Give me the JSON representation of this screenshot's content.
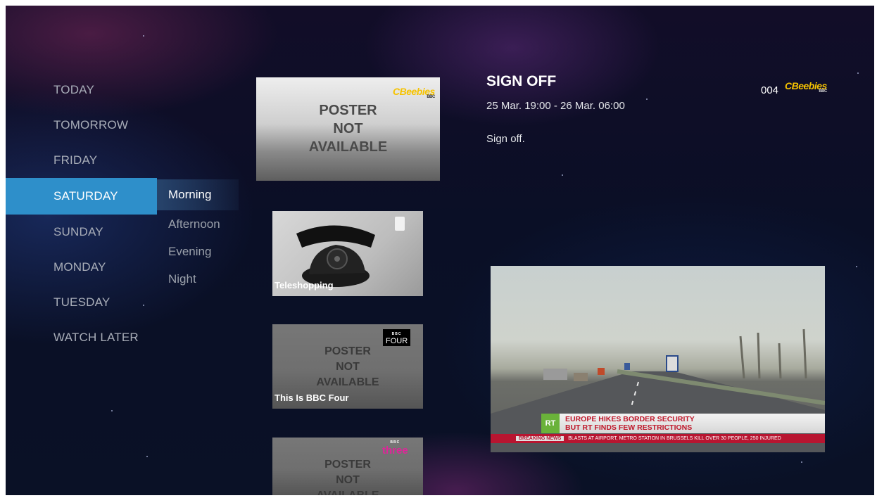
{
  "days": [
    "TODAY",
    "TOMORROW",
    "FRIDAY",
    "SATURDAY",
    "SUNDAY",
    "MONDAY",
    "TUESDAY",
    "WATCH LATER"
  ],
  "active_day": "SATURDAY",
  "times_of_day": [
    "Morning",
    "Afternoon",
    "Evening",
    "Night"
  ],
  "active_time_of_day": "Morning",
  "programs": [
    {
      "poster_lines": [
        "POSTER",
        "NOT",
        "AVAILABLE"
      ],
      "channel_logo": "CBeebies",
      "channel_logo_sub": "BBC"
    },
    {
      "title": "Teleshopping",
      "channel_logo": "channel-logo-icon"
    },
    {
      "title": "This Is BBC Four",
      "poster_lines": [
        "POSTER",
        "NOT",
        "AVAILABLE"
      ],
      "channel_logo": "BBC FOUR",
      "channel_logo_sub": "BBC",
      "channel_logo_main": "FOUR"
    },
    {
      "poster_lines": [
        "POSTER",
        "NOT",
        "AVAILABLE"
      ],
      "channel_logo": "BBC three",
      "channel_logo_sub": "BBC",
      "channel_logo_main": "three"
    }
  ],
  "detail": {
    "title": "SIGN OFF",
    "time": "25 Mar. 19:00 - 26 Mar. 06:00",
    "description": "Sign off.",
    "channel_number": "004",
    "channel_logo": "CBeebies",
    "channel_logo_sub": "BBC"
  },
  "preview": {
    "channel_logo": "RT",
    "headline_1": "EUROPE HIKES BORDER SECURITY",
    "headline_2": "BUT RT FINDS FEW RESTRICTIONS",
    "breaking_label": "BREAKING NEWS",
    "breaking_text": "BLASTS AT AIRPORT, METRO STATION IN BRUSSELS KILL OVER 30 PEOPLE, 250 INJURED"
  },
  "colors": {
    "accent": "#2e8fca",
    "cbeebies_yellow": "#f6c300",
    "three_pink": "#e0249a",
    "rt_green": "#6ab23a",
    "ticker_red": "#b81530"
  }
}
